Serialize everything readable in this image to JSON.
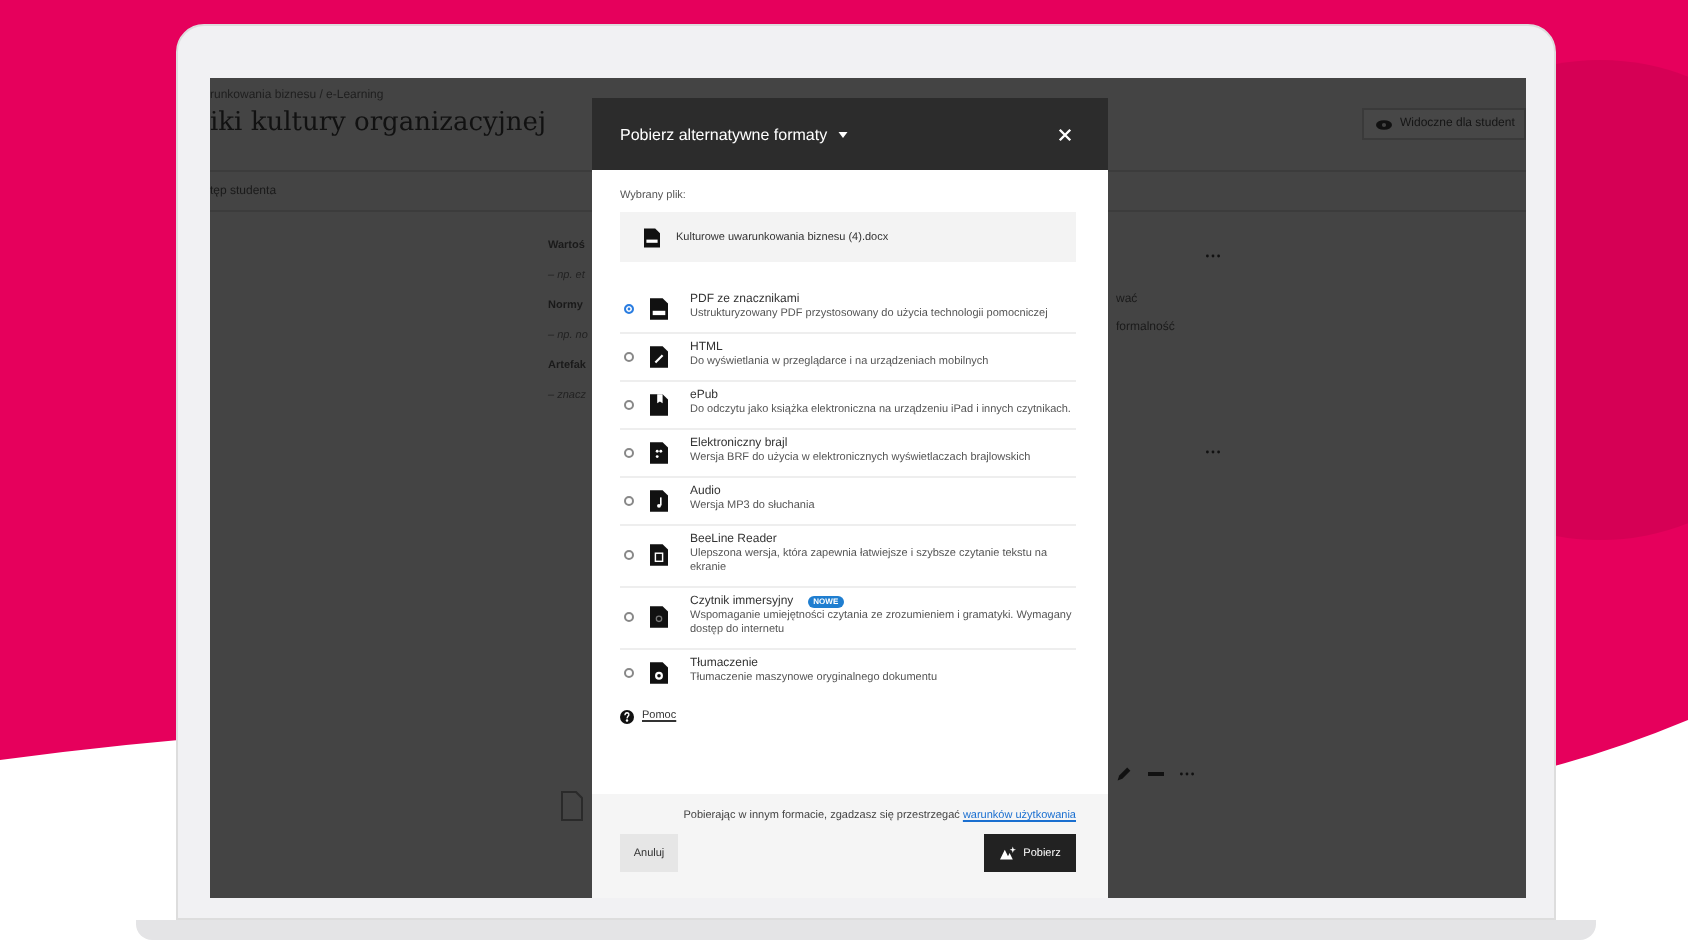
{
  "page": {
    "breadcrumb": "runkowania biznesu / e-Learning",
    "title": "iki kultury organizacyjnej",
    "tab": "tęp studenta",
    "visibility_button": "Widoczne dla student",
    "sections": [
      {
        "heading": "Wartoś",
        "text": "– np. et"
      },
      {
        "heading": "Normy",
        "text": "– np. no"
      },
      {
        "heading": "Artefak",
        "text": "– znacz"
      }
    ],
    "side_texts": [
      "wać",
      "formalność"
    ]
  },
  "dialog": {
    "title": "Pobierz alternatywne formaty",
    "selected_file_label": "Wybrany plik:",
    "file_name": "Kulturowe uwarunkowania biznesu (4).docx",
    "formats": [
      {
        "kind": "pdf",
        "name": "PDF ze znacznikami",
        "description": "Ustrukturyzowany PDF przystosowany do użycia technologii pomocniczej",
        "selected": true
      },
      {
        "kind": "html",
        "name": "HTML",
        "description": "Do wyświetlania w przeglądarce i na urządzeniach mobilnych",
        "selected": false
      },
      {
        "kind": "epub",
        "name": "ePub",
        "description": "Do odczytu jako książka elektroniczna na urządzeniu iPad i innych czytnikach.",
        "selected": false
      },
      {
        "kind": "braille",
        "name": "Elektroniczny brajl",
        "description": "Wersja BRF do użycia w elektronicznych wyświetlaczach brajlowskich",
        "selected": false
      },
      {
        "kind": "audio",
        "name": "Audio",
        "description": "Wersja MP3 do słuchania",
        "selected": false
      },
      {
        "kind": "beeline",
        "name": "BeeLine Reader",
        "description": "Ulepszona wersja, która zapewnia łatwiejsze i szybsze czytanie tekstu na ekranie",
        "selected": false
      },
      {
        "kind": "immersive",
        "name": "Czytnik immersyjny",
        "badge": "NOWE",
        "description": "Wspomaganie umiejętności czytania ze zrozumieniem i gramatyki. Wymagany dostęp do internetu",
        "selected": false
      },
      {
        "kind": "translation",
        "name": "Tłumaczenie",
        "description": "Tłumaczenie maszynowe oryginalnego dokumentu",
        "selected": false
      }
    ],
    "help_link": "Pomoc",
    "notice": "Pobierając w innym formacie, zgadzasz się przestrzegać",
    "notice_link": "warunków użytkowania",
    "cancel": "Anuluj",
    "download": "Pobierz"
  }
}
